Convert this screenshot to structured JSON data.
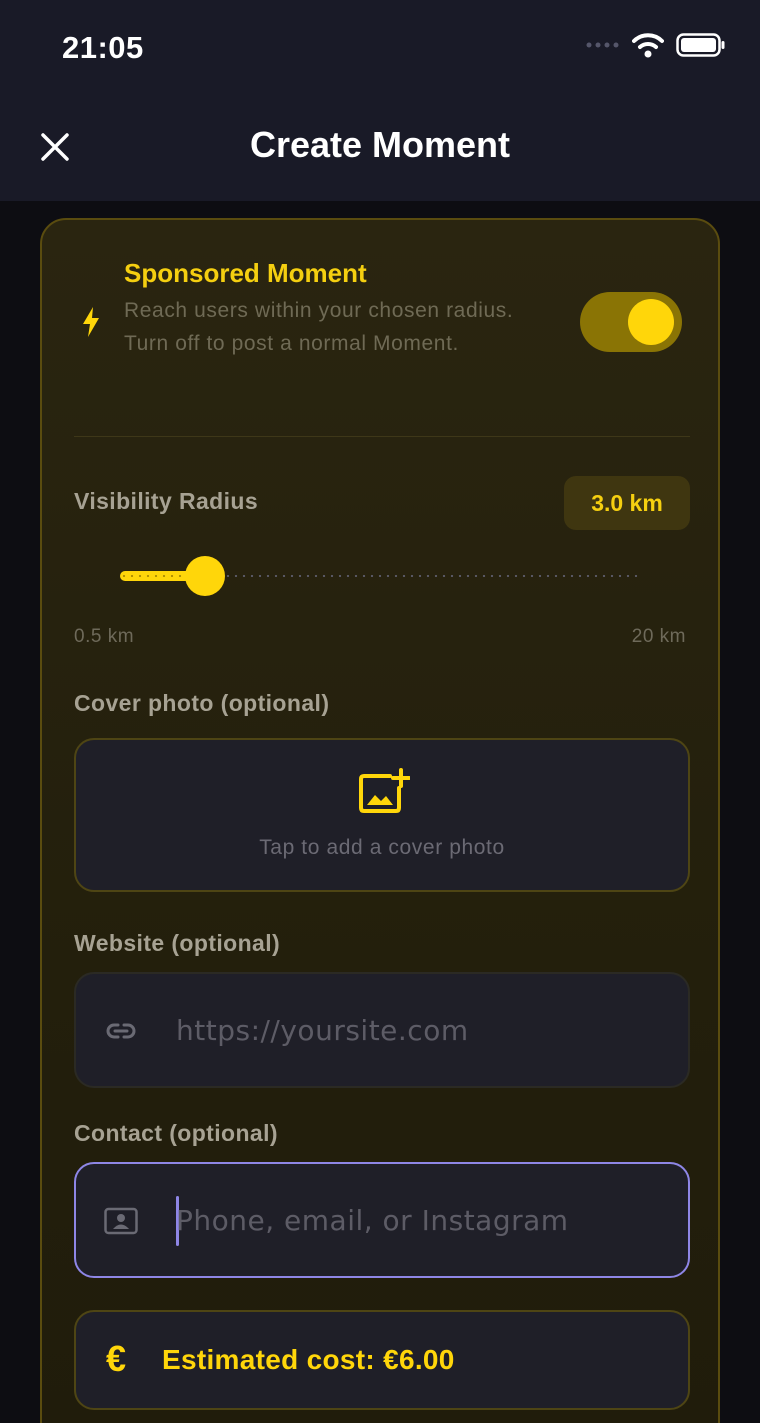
{
  "status_bar": {
    "time": "21:05"
  },
  "header": {
    "title": "Create Moment"
  },
  "sponsored": {
    "title": "Sponsored Moment",
    "description": "Reach users within your chosen radius. Turn off to post a normal Moment.",
    "enabled": true
  },
  "radius": {
    "label": "Visibility Radius",
    "value_text": "3.0 km",
    "value_km": 3.0,
    "min_label": "0.5 km",
    "max_label": "20 km",
    "min_km": 0.5,
    "max_km": 20
  },
  "cover_photo": {
    "label": "Cover photo (optional)",
    "prompt": "Tap to add a cover photo"
  },
  "website": {
    "label": "Website (optional)",
    "placeholder": "https://yoursite.com",
    "value": ""
  },
  "contact": {
    "label": "Contact (optional)",
    "placeholder": "Phone, email, or Instagram",
    "value": ""
  },
  "cost": {
    "symbol": "€",
    "text": "Estimated cost: €6.00"
  },
  "colors": {
    "accent": "#ffd60a",
    "focus": "#8e86e6",
    "header_bg": "#191a27"
  },
  "icons": [
    "close-icon",
    "bolt-icon",
    "add-photo-icon",
    "link-icon",
    "contact-card-icon",
    "wifi-icon",
    "battery-icon",
    "cellular-icon"
  ]
}
